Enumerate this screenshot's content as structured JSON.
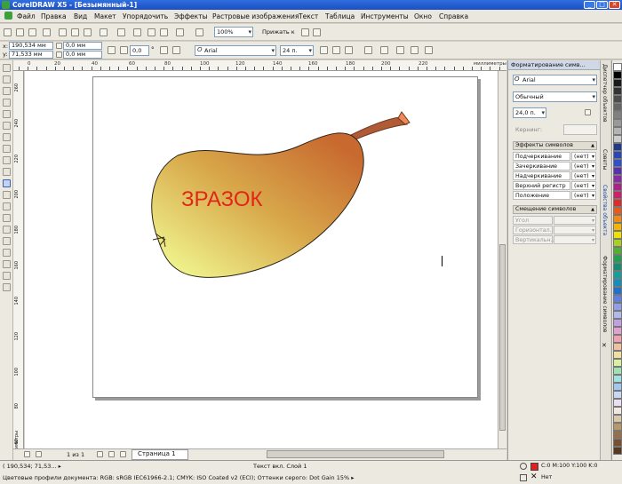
{
  "window": {
    "title": "CorelDRAW X5 - [Безымянный-1]",
    "min": "_",
    "max": "□",
    "close": "✕"
  },
  "menu": [
    "Файл",
    "Правка",
    "Вид",
    "Макет",
    "Упорядочить",
    "Эффекты",
    "Растровые изображения",
    "Текст",
    "Таблица",
    "Инструменты",
    "Окно",
    "Справка"
  ],
  "toolbar": {
    "zoom": "100%",
    "snap": "Прижать к"
  },
  "propbar": {
    "x": "190,534 мм",
    "y": "71,533 мм",
    "w": "0,0 мм",
    "h": "0,0 мм",
    "angle": "0,0",
    "degree": "°",
    "font": "Arial",
    "size": "24 п."
  },
  "ruler": {
    "unit": "миллиметры",
    "left_unit": "миллиметры",
    "top_labels": [
      "0",
      "20",
      "40",
      "60",
      "80",
      "100",
      "120",
      "140",
      "160",
      "180",
      "200",
      "220"
    ],
    "left_labels": [
      "260",
      "240",
      "220",
      "200",
      "180",
      "160",
      "140",
      "120",
      "100",
      "80",
      "60",
      "40"
    ]
  },
  "canvas": {
    "artwork_text": "ЗРАЗОК"
  },
  "pages": {
    "counter": "1 из 1",
    "tab": "Страница 1"
  },
  "docker": {
    "title": "Форматирование симв...",
    "font": "Arial",
    "style": "Обычный",
    "size": "24,0 п.",
    "kerning_label": "Кернинг:",
    "effects_header": "Эффекты символов",
    "effects": [
      {
        "label": "Подчеркивание",
        "value": "(нет)"
      },
      {
        "label": "Зачеркивание",
        "value": "(нет)"
      },
      {
        "label": "Надчеркивание",
        "value": "(нет)"
      },
      {
        "label": "Верхний регистр",
        "value": "(нет)"
      },
      {
        "label": "Положение",
        "value": "(нет)"
      }
    ],
    "offset_header": "Смещение символов",
    "offsets": [
      "Угол",
      "Горизонтал...",
      "Вертикальн..."
    ]
  },
  "side_tabs": [
    "Диспетчер объектов",
    "Советы",
    "Свойства объекта",
    "Форматирование символов"
  ],
  "palette": [
    "#ffffff",
    "#000000",
    "#1a1a1a",
    "#333333",
    "#4d4d4d",
    "#666666",
    "#808080",
    "#999999",
    "#b3b3b3",
    "#cccccc",
    "#1e3a8a",
    "#2a46b8",
    "#3050d0",
    "#5a30b0",
    "#8a2aa8",
    "#b0208a",
    "#d0206a",
    "#e02a2a",
    "#e85a1a",
    "#f08a10",
    "#f5b400",
    "#f0e000",
    "#a8d020",
    "#50b030",
    "#20a050",
    "#109070",
    "#10a0a0",
    "#1090c0",
    "#2070d0",
    "#6080e0",
    "#90a0e8",
    "#b0b8ee",
    "#c0a0e0",
    "#e0a0d0",
    "#f0a0b0",
    "#f0c0a0",
    "#f0e0a0",
    "#d8f0a0",
    "#a0e0b0",
    "#a0e0e0",
    "#a0c8f0",
    "#c8d8f0",
    "#e8e0f0",
    "#f0e8e0",
    "#d8c8a8",
    "#b89868",
    "#987048",
    "#785030",
    "#583820"
  ],
  "status": {
    "coords": "( 190,534; 71,53... ▸",
    "layer": "Текст вкл. Слой 1",
    "profiles": "Цветовые профили документа: RGB: sRGB IEC61966-2.1; CMYK: ISO Coated v2 (ECI); Оттенки серого: Dot Gain 15% ▸",
    "fill": "C:0 M:100 Y:100 K:0",
    "outline": "Нет",
    "fill_color": "#e02020"
  }
}
